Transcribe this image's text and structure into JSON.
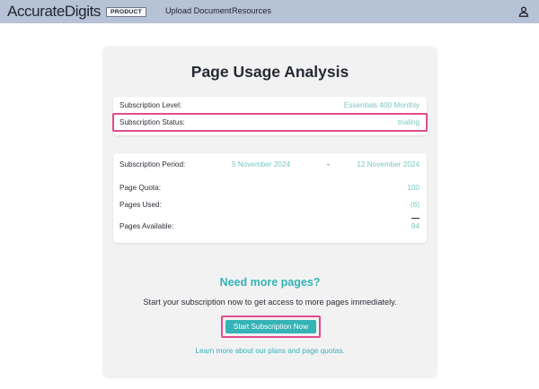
{
  "nav": {
    "brand_text": "AccurateDigits",
    "brand_badge": "PRODUCT",
    "links": [
      "Upload Document",
      "Resources"
    ],
    "user_icon": "user-icon"
  },
  "usage": {
    "title": "Page Usage Analysis",
    "subscription": {
      "level_label": "Subscription Level:",
      "level_value": "Essentials 400 Monthly",
      "status_label": "Subscription Status:",
      "status_value": "trialing"
    },
    "period": {
      "label": "Subscription Period:",
      "start": "5 November 2024",
      "separator": "-",
      "end": "12 November 2024"
    },
    "quota": {
      "quota_label": "Page Quota:",
      "quota_value": "100",
      "used_label": "Pages Used:",
      "used_value": "(6)",
      "available_label": "Pages Available:",
      "available_value": "94"
    }
  },
  "cta": {
    "title": "Need more pages?",
    "text": "Start your subscription now to get access to more pages immediately.",
    "button": "Start Subscription Now",
    "link": "Learn more about our plans and page quotas."
  },
  "colors": {
    "topbar": "#b6c2d6",
    "accent": "#35b3b6",
    "value_text": "#7bc6c2",
    "highlight": "#e04c8c"
  }
}
